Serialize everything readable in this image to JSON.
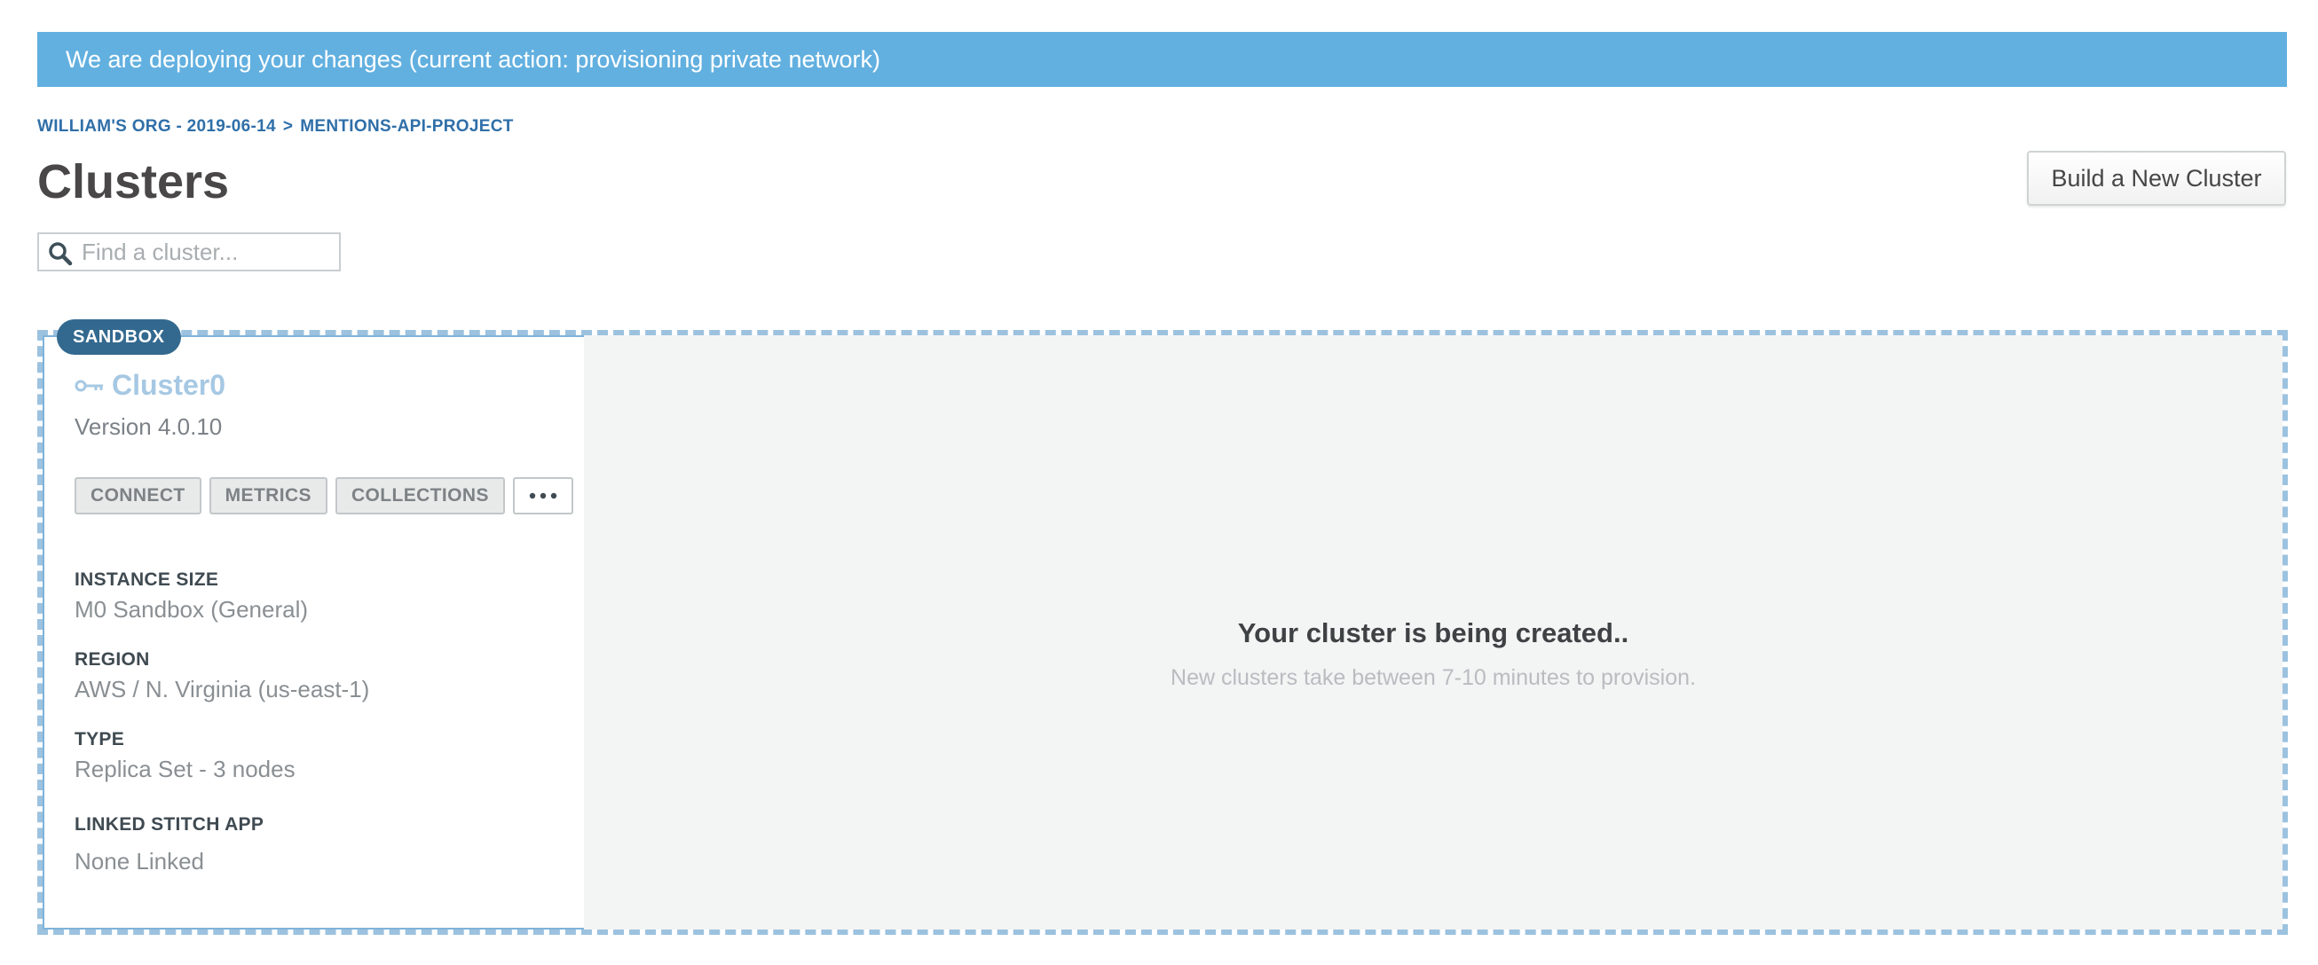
{
  "banner": {
    "message": "We are deploying your changes (current action: provisioning private network)"
  },
  "breadcrumb": {
    "org": "WILLIAM'S ORG - 2019-06-14",
    "separator": ">",
    "project": "MENTIONS-API-PROJECT"
  },
  "header": {
    "title": "Clusters",
    "build_button_label": "Build a New Cluster"
  },
  "search": {
    "placeholder": "Find a cluster...",
    "value": "",
    "icon": "search-icon"
  },
  "cluster": {
    "tier_badge": "SANDBOX",
    "name": "Cluster0",
    "name_icon": "key-icon",
    "version": "Version 4.0.10",
    "actions": {
      "connect": "CONNECT",
      "metrics": "METRICS",
      "collections": "COLLECTIONS",
      "more_icon": "ellipsis-icon"
    },
    "details": {
      "instance_size_label": "INSTANCE SIZE",
      "instance_size_value": "M0 Sandbox (General)",
      "region_label": "REGION",
      "region_value": "AWS / N. Virginia (us-east-1)",
      "type_label": "TYPE",
      "type_value": "Replica Set - 3 nodes",
      "stitch_label": "LINKED STITCH APP",
      "stitch_value": "None Linked"
    },
    "status": {
      "title": "Your cluster is being created..",
      "subtitle": "New clusters take between 7-10 minutes to provision."
    }
  },
  "colors": {
    "banner_bg": "#62b0e0",
    "link_blue": "#2f6fa8",
    "badge_bg": "#33698f",
    "cluster_name": "#a6c8e3",
    "card_border": "#9cc2df"
  }
}
